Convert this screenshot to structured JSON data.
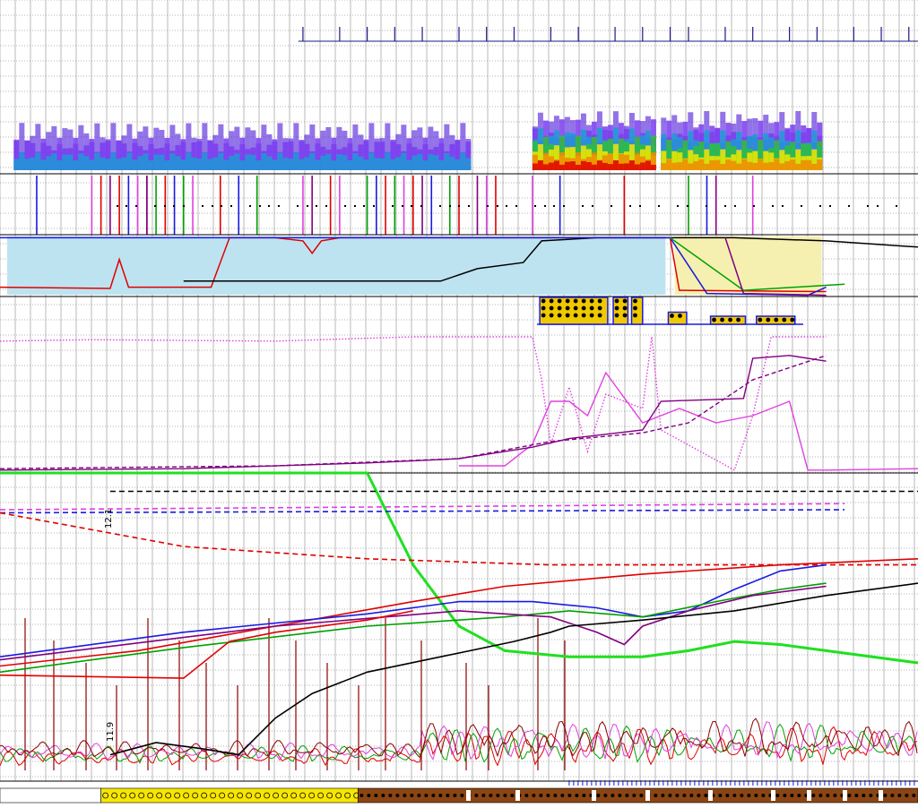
{
  "chart_data": [
    {
      "type": "line",
      "panel": "event-markers",
      "title": "",
      "xlabel": "",
      "ylabel": "",
      "grid": true,
      "x_markers": [
        0.33,
        0.37,
        0.4,
        0.43,
        0.46,
        0.5,
        0.53,
        0.56,
        0.6,
        0.63,
        0.67,
        0.7,
        0.73,
        0.75,
        0.79,
        0.82,
        0.86,
        0.89,
        0.93,
        0.96,
        0.99
      ]
    },
    {
      "type": "heatmap",
      "panel": "spectrogram",
      "title": "",
      "colors": [
        "#3a00d6",
        "#7a3cf0",
        "#1c9ad6",
        "#2fbf3a",
        "#f2e600",
        "#f08a00",
        "#e00000"
      ],
      "segments": [
        {
          "x_start": 0.015,
          "x_end": 0.51,
          "max_level": 2
        },
        {
          "x_start": 0.58,
          "x_end": 0.71,
          "max_level": 6
        },
        {
          "x_start": 0.72,
          "x_end": 0.89,
          "max_level": 5
        }
      ]
    },
    {
      "type": "line",
      "panel": "event-lines",
      "title": "",
      "series": [
        {
          "color": "#e00000",
          "x": [
            0.11,
            0.13,
            0.16,
            0.18,
            0.24,
            0.36,
            0.42,
            0.45,
            0.5,
            0.54,
            0.68
          ]
        },
        {
          "color": "#1a1ae0",
          "x": [
            0.04,
            0.14,
            0.19,
            0.26,
            0.41,
            0.47,
            0.61,
            0.77
          ]
        },
        {
          "color": "#00a000",
          "x": [
            0.17,
            0.2,
            0.28,
            0.4,
            0.43,
            0.49,
            0.75
          ]
        },
        {
          "color": "#e040e0",
          "x": [
            0.1,
            0.15,
            0.21,
            0.33,
            0.37,
            0.44,
            0.53,
            0.58,
            0.82
          ]
        },
        {
          "color": "#800080",
          "x": [
            0.12,
            0.16,
            0.34,
            0.46,
            0.52,
            0.78
          ]
        }
      ]
    },
    {
      "type": "area",
      "panel": "band-panel",
      "title": "",
      "fill_colors": [
        "#bde3f0",
        "#f5f0b0"
      ],
      "series": [
        {
          "name": "",
          "color": "#e00000",
          "points": [
            [
              0,
              0.85
            ],
            [
              0.12,
              0.87
            ],
            [
              0.13,
              0.4
            ],
            [
              0.14,
              0.85
            ],
            [
              0.23,
              0.85
            ],
            [
              0.25,
              0.05
            ],
            [
              0.3,
              0.05
            ],
            [
              0.33,
              0.1
            ],
            [
              0.34,
              0.3
            ],
            [
              0.35,
              0.1
            ],
            [
              0.37,
              0.05
            ],
            [
              0.6,
              0.05
            ],
            [
              0.73,
              0.05
            ],
            [
              0.74,
              0.9
            ],
            [
              0.9,
              0.92
            ]
          ]
        },
        {
          "name": "",
          "color": "#000000",
          "points": [
            [
              0.2,
              0.75
            ],
            [
              0.48,
              0.75
            ],
            [
              0.52,
              0.55
            ],
            [
              0.57,
              0.45
            ],
            [
              0.59,
              0.1
            ],
            [
              0.65,
              0.05
            ],
            [
              0.66,
              0.05
            ],
            [
              0.73,
              0.05
            ],
            [
              0.8,
              0.05
            ],
            [
              0.9,
              0.1
            ],
            [
              1,
              0.2
            ]
          ]
        },
        {
          "name": "",
          "color": "#1a1ae0",
          "points": [
            [
              0,
              0.05
            ],
            [
              0.25,
              0.05
            ],
            [
              0.73,
              0.05
            ],
            [
              0.77,
              0.95
            ],
            [
              0.88,
              0.98
            ],
            [
              0.9,
              0.85
            ]
          ]
        },
        {
          "name": "",
          "color": "#00a000",
          "points": [
            [
              0.73,
              0.05
            ],
            [
              0.81,
              0.9
            ],
            [
              0.92,
              0.8
            ]
          ]
        },
        {
          "name": "",
          "color": "#800080",
          "points": [
            [
              0.79,
              0.05
            ],
            [
              0.81,
              0.95
            ],
            [
              0.9,
              0.98
            ]
          ]
        }
      ]
    },
    {
      "type": "bar",
      "panel": "pattern-blocks",
      "title": "",
      "colors": [
        "#1a1ae0",
        "#f0c800",
        "#000000"
      ],
      "blocks": [
        {
          "x_start": 0.588,
          "x_end": 0.662,
          "height": 1.0
        },
        {
          "x_start": 0.668,
          "x_end": 0.684,
          "height": 1.0
        },
        {
          "x_start": 0.688,
          "x_end": 0.7,
          "height": 1.0
        },
        {
          "x_start": 0.728,
          "x_end": 0.748,
          "height": 0.45
        },
        {
          "x_start": 0.774,
          "x_end": 0.812,
          "height": 0.3
        },
        {
          "x_start": 0.824,
          "x_end": 0.866,
          "height": 0.3
        }
      ]
    },
    {
      "type": "line",
      "panel": "middle-traces",
      "title": "",
      "series": [
        {
          "name": "",
          "color": "#e040e0",
          "dash": "dotted",
          "points": [
            [
              0,
              0.08
            ],
            [
              0.1,
              0.07
            ],
            [
              0.3,
              0.08
            ],
            [
              0.45,
              0.05
            ],
            [
              0.58,
              0.05
            ],
            [
              0.59,
              0.35
            ],
            [
              0.6,
              0.8
            ],
            [
              0.62,
              0.4
            ],
            [
              0.64,
              0.85
            ],
            [
              0.66,
              0.45
            ],
            [
              0.68,
              0.5
            ],
            [
              0.7,
              0.55
            ],
            [
              0.71,
              0.05
            ],
            [
              0.72,
              0.7
            ],
            [
              0.8,
              0.98
            ],
            [
              0.82,
              0.6
            ],
            [
              0.84,
              0.05
            ],
            [
              0.9,
              0.05
            ]
          ]
        },
        {
          "name": "",
          "color": "#e040e0",
          "dash": "solid",
          "points": [
            [
              0.5,
              0.95
            ],
            [
              0.55,
              0.95
            ],
            [
              0.58,
              0.8
            ],
            [
              0.6,
              0.5
            ],
            [
              0.62,
              0.5
            ],
            [
              0.64,
              0.6
            ],
            [
              0.66,
              0.3
            ],
            [
              0.7,
              0.65
            ],
            [
              0.74,
              0.55
            ],
            [
              0.78,
              0.65
            ],
            [
              0.82,
              0.6
            ],
            [
              0.86,
              0.5
            ],
            [
              0.88,
              0.98
            ],
            [
              0.9,
              0.98
            ],
            [
              1,
              0.97
            ]
          ]
        },
        {
          "name": "",
          "color": "#800080",
          "dash": "solid",
          "points": [
            [
              0,
              0.98
            ],
            [
              0.2,
              0.97
            ],
            [
              0.4,
              0.93
            ],
            [
              0.5,
              0.9
            ],
            [
              0.58,
              0.82
            ],
            [
              0.62,
              0.76
            ],
            [
              0.7,
              0.7
            ],
            [
              0.72,
              0.5
            ],
            [
              0.81,
              0.48
            ],
            [
              0.82,
              0.2
            ],
            [
              0.86,
              0.18
            ],
            [
              0.9,
              0.22
            ]
          ]
        },
        {
          "name": "",
          "color": "#800080",
          "dash": "dashed",
          "points": [
            [
              0,
              0.97
            ],
            [
              0.3,
              0.95
            ],
            [
              0.5,
              0.9
            ],
            [
              0.6,
              0.78
            ],
            [
              0.7,
              0.72
            ],
            [
              0.75,
              0.65
            ],
            [
              0.82,
              0.35
            ],
            [
              0.9,
              0.18
            ]
          ]
        }
      ]
    },
    {
      "type": "line",
      "panel": "bottom-chart",
      "title": "",
      "xlabel": "",
      "ylabel": "",
      "tick_labels": [
        "12.1",
        "11.9"
      ],
      "series": [
        {
          "name": "",
          "color": "#20e020",
          "dash": "solid",
          "points": [
            [
              0,
              0
            ],
            [
              0.4,
              0
            ],
            [
              0.45,
              0.3
            ],
            [
              0.5,
              0.5
            ],
            [
              0.55,
              0.58
            ],
            [
              0.62,
              0.6
            ],
            [
              0.7,
              0.6
            ],
            [
              0.75,
              0.58
            ],
            [
              0.8,
              0.55
            ],
            [
              0.85,
              0.56
            ],
            [
              0.9,
              0.58
            ],
            [
              1,
              0.62
            ]
          ]
        },
        {
          "name": "",
          "color": "#000000",
          "dash": "dashed",
          "points": [
            [
              0.12,
              0.06
            ],
            [
              1,
              0.06
            ]
          ]
        },
        {
          "name": "",
          "color": "#e040e0",
          "dash": "dashed",
          "points": [
            [
              0,
              0.12
            ],
            [
              0.92,
              0.1
            ]
          ]
        },
        {
          "name": "",
          "color": "#1a1ae0",
          "dash": "dashed",
          "points": [
            [
              0,
              0.13
            ],
            [
              0.92,
              0.12
            ]
          ]
        },
        {
          "name": "",
          "color": "#e00000",
          "dash": "dashed",
          "points": [
            [
              0,
              0.13
            ],
            [
              0.2,
              0.24
            ],
            [
              0.4,
              0.28
            ],
            [
              0.6,
              0.3
            ],
            [
              1,
              0.3
            ]
          ]
        },
        {
          "name": "",
          "color": "#e00000",
          "dash": "solid",
          "points": [
            [
              0,
              0.63
            ],
            [
              0.15,
              0.58
            ],
            [
              0.3,
              0.5
            ],
            [
              0.45,
              0.42
            ],
            [
              0.55,
              0.37
            ],
            [
              0.7,
              0.33
            ],
            [
              0.85,
              0.3
            ],
            [
              1,
              0.28
            ]
          ]
        },
        {
          "name": "",
          "color": "#1a1ae0",
          "dash": "solid",
          "points": [
            [
              0,
              0.6
            ],
            [
              0.2,
              0.52
            ],
            [
              0.4,
              0.46
            ],
            [
              0.5,
              0.42
            ],
            [
              0.58,
              0.42
            ],
            [
              0.65,
              0.44
            ],
            [
              0.7,
              0.47
            ],
            [
              0.75,
              0.45
            ],
            [
              0.8,
              0.38
            ],
            [
              0.85,
              0.32
            ],
            [
              0.9,
              0.3
            ]
          ]
        },
        {
          "name": "",
          "color": "#00a000",
          "dash": "solid",
          "points": [
            [
              0,
              0.65
            ],
            [
              0.2,
              0.57
            ],
            [
              0.4,
              0.5
            ],
            [
              0.55,
              0.47
            ],
            [
              0.62,
              0.45
            ],
            [
              0.7,
              0.47
            ],
            [
              0.78,
              0.42
            ],
            [
              0.85,
              0.38
            ],
            [
              0.9,
              0.36
            ]
          ]
        },
        {
          "name": "",
          "color": "#800080",
          "dash": "solid",
          "points": [
            [
              0,
              0.61
            ],
            [
              0.3,
              0.5
            ],
            [
              0.5,
              0.45
            ],
            [
              0.6,
              0.47
            ],
            [
              0.65,
              0.52
            ],
            [
              0.68,
              0.56
            ],
            [
              0.7,
              0.5
            ],
            [
              0.75,
              0.45
            ],
            [
              0.82,
              0.4
            ],
            [
              0.9,
              0.37
            ]
          ]
        },
        {
          "name": "",
          "color": "#000000",
          "dash": "solid",
          "points": [
            [
              0.12,
              0.92
            ],
            [
              0.17,
              0.88
            ],
            [
              0.22,
              0.9
            ],
            [
              0.26,
              0.92
            ],
            [
              0.3,
              0.8
            ],
            [
              0.34,
              0.72
            ],
            [
              0.4,
              0.65
            ],
            [
              0.48,
              0.6
            ],
            [
              0.56,
              0.55
            ],
            [
              0.6,
              0.52
            ],
            [
              0.62,
              0.5
            ],
            [
              0.7,
              0.48
            ],
            [
              0.8,
              0.45
            ],
            [
              0.9,
              0.4
            ],
            [
              1,
              0.36
            ]
          ]
        },
        {
          "name": "",
          "color": "#e00000",
          "dash": "solid",
          "points": [
            [
              0,
              0.66
            ],
            [
              0.2,
              0.67
            ],
            [
              0.25,
              0.55
            ],
            [
              0.3,
              0.52
            ],
            [
              0.4,
              0.48
            ],
            [
              0.45,
              0.45
            ]
          ]
        }
      ]
    },
    {
      "type": "bar",
      "panel": "bottom-strip",
      "title": "",
      "colors": [
        "#f7e600",
        "#8b4513",
        "#ffffff",
        "#1a1ae0"
      ],
      "segments": [
        {
          "x_start": 0.0,
          "x_end": 0.11,
          "color": "#ffffff"
        },
        {
          "x_start": 0.11,
          "x_end": 0.39,
          "color": "#f7e600"
        },
        {
          "x_start": 0.39,
          "x_end": 1.0,
          "color": "#8b4513"
        }
      ]
    }
  ]
}
